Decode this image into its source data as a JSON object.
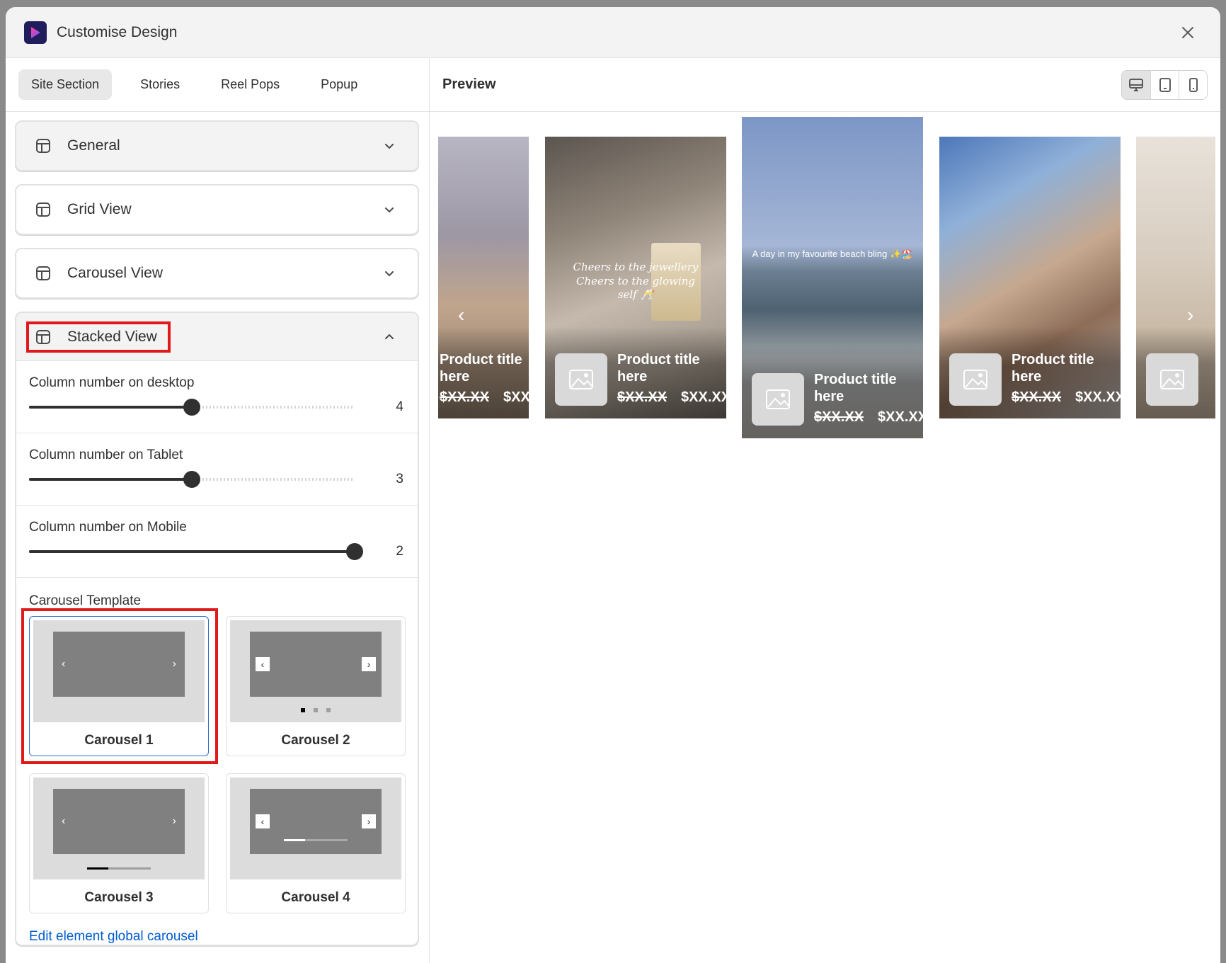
{
  "header": {
    "title": "Customise Design",
    "close_label": "×"
  },
  "tabs": [
    {
      "label": "Site Section",
      "active": true
    },
    {
      "label": "Stories",
      "active": false
    },
    {
      "label": "Reel Pops",
      "active": false
    },
    {
      "label": "Popup",
      "active": false
    }
  ],
  "sections": {
    "general": "General",
    "grid": "Grid View",
    "carousel": "Carousel View",
    "stacked": "Stacked View"
  },
  "sliders": [
    {
      "label": "Column number on desktop",
      "value": "4",
      "fraction": 0.5
    },
    {
      "label": "Column number on Tablet",
      "value": "3",
      "fraction": 0.5
    },
    {
      "label": "Column number on Mobile",
      "value": "2",
      "fraction": 1.0
    }
  ],
  "template": {
    "title": "Carousel Template",
    "items": [
      "Carousel 1",
      "Carousel 2",
      "Carousel 3",
      "Carousel 4"
    ],
    "selected": "Carousel 1"
  },
  "edit_link": "Edit element global carousel",
  "preview": {
    "title": "Preview",
    "devices": [
      "desktop-icon",
      "tablet-icon",
      "mobile-icon"
    ],
    "cards": [
      {
        "title": "Product title here",
        "price_old": "$XX.XX",
        "price_new": "$XX.XX",
        "caption": ""
      },
      {
        "title": "Product title here",
        "price_old": "$XX.XX",
        "price_new": "$XX.XX",
        "caption": "Cheers to the jewellery Cheers to the glowing self 🥂"
      },
      {
        "title": "Product title here",
        "price_old": "$XX.XX",
        "price_new": "$XX.XX",
        "caption": "A day in my favourite beach bling ✨🏖️"
      },
      {
        "title": "Product title here",
        "price_old": "$XX.XX",
        "price_new": "$XX.XX",
        "caption": ""
      }
    ]
  },
  "colors": {
    "accent": "#005bd3",
    "highlight": "#e0191b",
    "selected_border": "#2c6ecb"
  }
}
